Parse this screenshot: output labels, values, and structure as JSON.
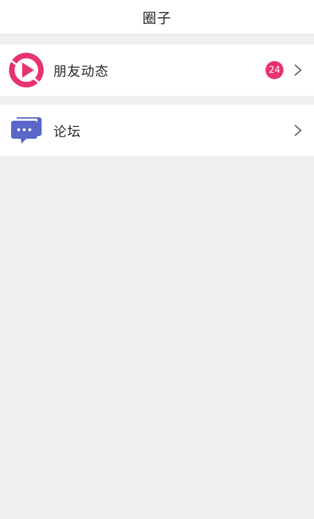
{
  "header": {
    "title": "圈子"
  },
  "items": [
    {
      "label": "朋友动态",
      "icon": "play-circle-icon",
      "badge": "24",
      "accent": "#e8336e"
    },
    {
      "label": "论坛",
      "icon": "chat-bubbles-icon",
      "accent": "#5a67c8"
    }
  ]
}
